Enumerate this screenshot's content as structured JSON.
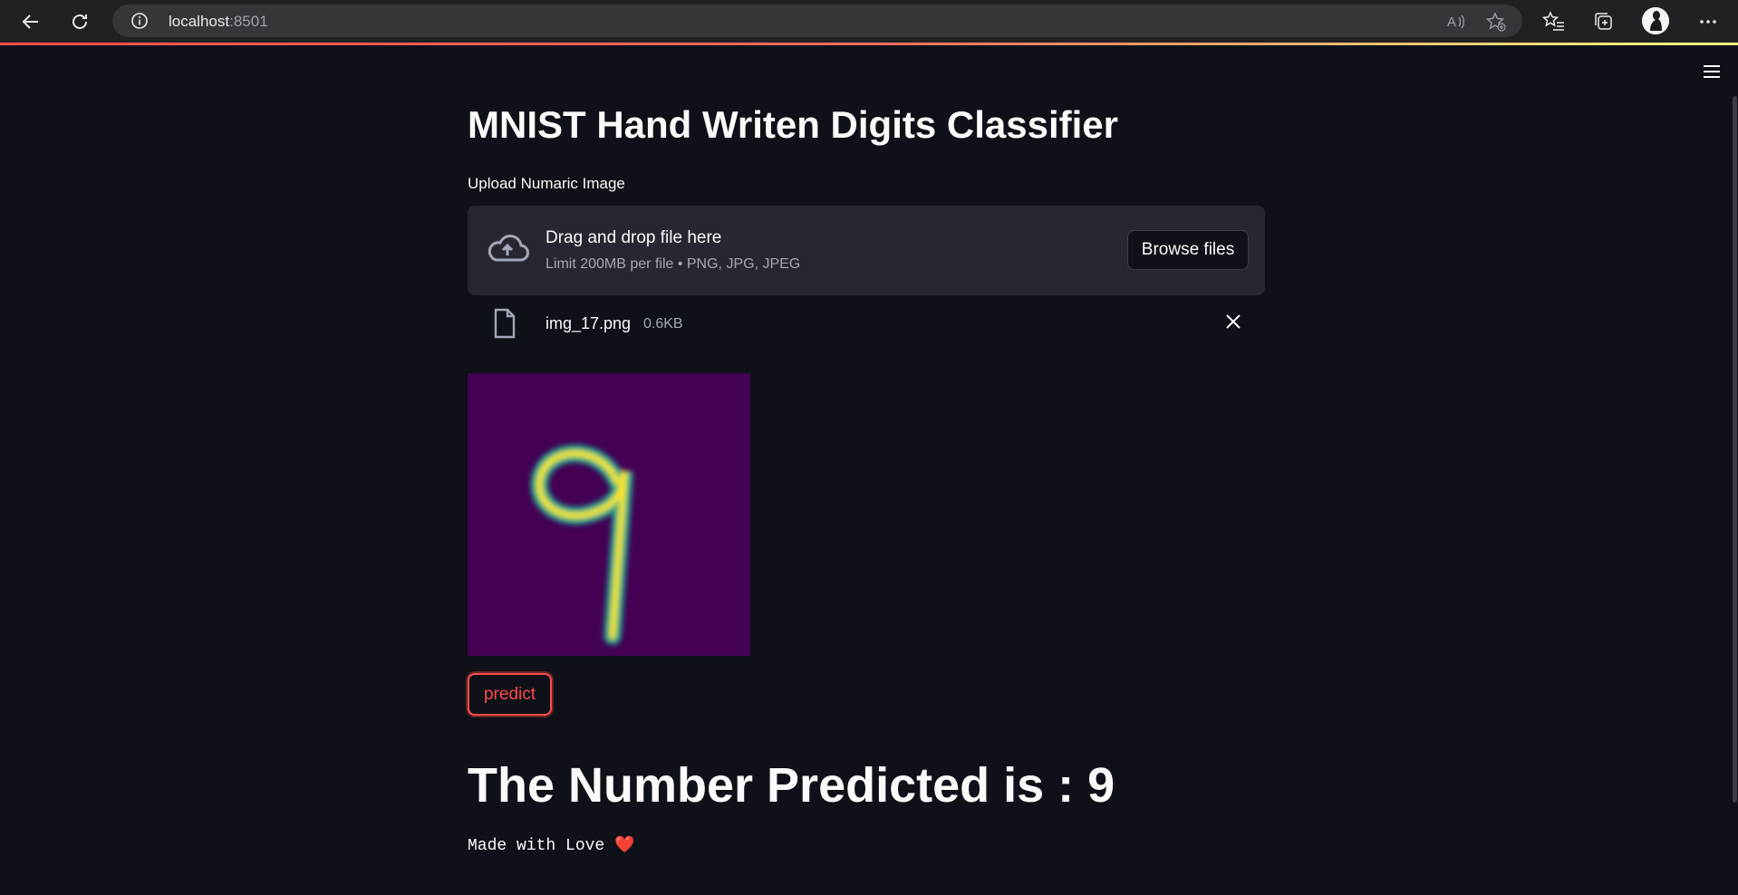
{
  "browser": {
    "host": "localhost",
    "port": ":8501"
  },
  "app": {
    "title": "MNIST Hand Writen Digits Classifier",
    "uploader": {
      "label": "Upload Numaric Image",
      "drop_text": "Drag and drop file here",
      "limit_text": "Limit 200MB per file • PNG, JPG, JPEG",
      "browse_label": "Browse files"
    },
    "uploaded_file": {
      "name": "img_17.png",
      "size": "0.6KB"
    },
    "image": {
      "background_color": "#440154",
      "stroke_colors": [
        "#fde725",
        "#35b779",
        "#21918c"
      ]
    },
    "predict_label": "predict",
    "result_text": "The Number Predicted is : 9",
    "footer_text": "Made with Love ❤️"
  },
  "colors": {
    "background": "#0e1117",
    "accent": "#ff4b4b",
    "dropzone": "#262730"
  }
}
